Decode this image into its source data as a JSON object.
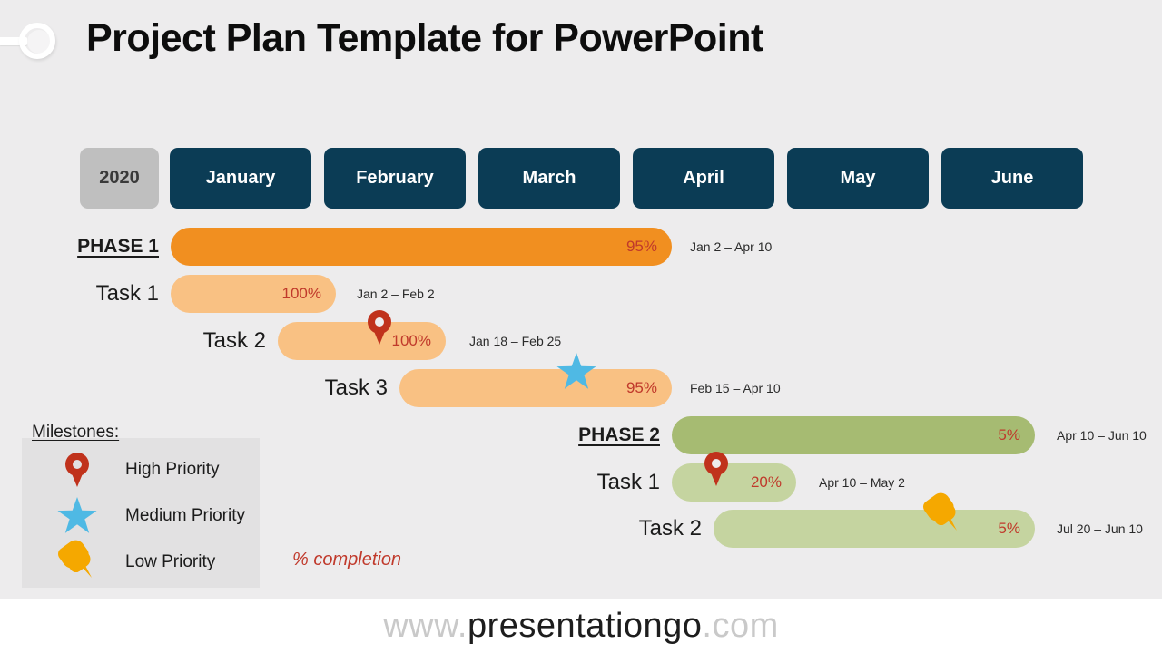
{
  "slide": {
    "title": "Project Plan Template for PowerPoint",
    "background_color": "#edeced",
    "decorative_ring_color": "#ffffff"
  },
  "timeline": {
    "year_label": "2020",
    "year_cell_color": "#bfbfbf",
    "month_cell_color": "#0b3c55",
    "months": [
      {
        "label": "January"
      },
      {
        "label": "February"
      },
      {
        "label": "March"
      },
      {
        "label": "April"
      },
      {
        "label": "May"
      },
      {
        "label": "June"
      }
    ]
  },
  "gantt": {
    "percent_color": "#c0392b",
    "rows": [
      {
        "label": "PHASE 1",
        "type": "phase",
        "percent": "95%",
        "dates": "Jan 2 – Apr 10",
        "bar_color": "#f18f20"
      },
      {
        "label": "Task 1",
        "type": "task",
        "percent": "100%",
        "dates": "Jan 2 – Feb 2",
        "bar_color": "#f9c183"
      },
      {
        "label": "Task 2",
        "type": "task",
        "percent": "100%",
        "dates": "Jan 18 – Feb 25",
        "bar_color": "#f9c183",
        "marker": "high-priority-pin-icon"
      },
      {
        "label": "Task 3",
        "type": "task",
        "percent": "95%",
        "dates": "Feb 15 – Apr 10",
        "bar_color": "#f9c183",
        "marker": "medium-priority-star-icon"
      },
      {
        "label": "PHASE 2",
        "type": "phase",
        "percent": "5%",
        "dates": "Apr 10 – Jun 10",
        "bar_color": "#a6bb72"
      },
      {
        "label": "Task 1",
        "type": "task",
        "percent": "20%",
        "dates": "Apr 10 – May 2",
        "bar_color": "#c5d4a0",
        "marker": "high-priority-pin-icon"
      },
      {
        "label": "Task 2",
        "type": "task",
        "percent": "5%",
        "dates": "Jul 20 – Jun 10",
        "bar_color": "#c5d4a0",
        "marker": "low-priority-pushpin-icon"
      }
    ]
  },
  "legend": {
    "title": "Milestones:",
    "items": [
      {
        "label": "High Priority",
        "icon": "pin-icon",
        "color": "#c0321c"
      },
      {
        "label": "Medium Priority",
        "icon": "star-icon",
        "color": "#4fb9e4"
      },
      {
        "label": "Low Priority",
        "icon": "pushpin-icon",
        "color": "#f5a800"
      }
    ]
  },
  "completion_note": "% completion",
  "footer": {
    "prefix": "www.",
    "brand": "presentationgo",
    "suffix": ".com"
  }
}
